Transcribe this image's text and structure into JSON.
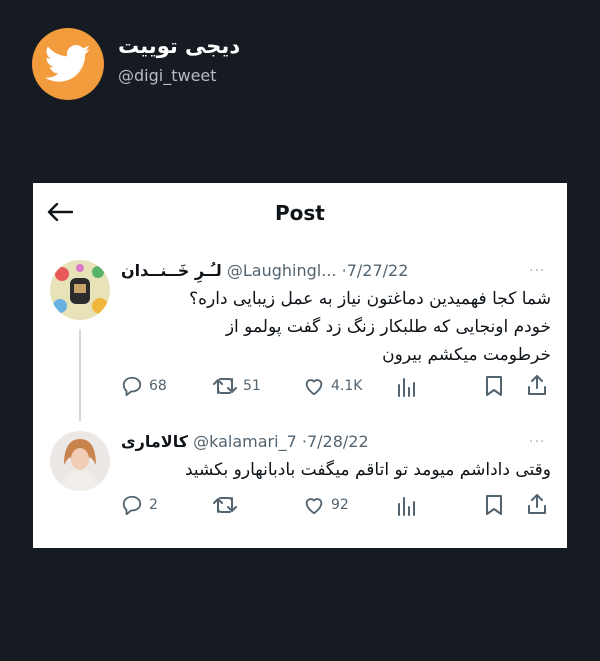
{
  "brand": {
    "name": "دیجی توییت",
    "handle": "@digi_tweet"
  },
  "header": {
    "title": "Post"
  },
  "tweets": [
    {
      "name": "لـُـرِ خَــنــدان",
      "handle": "@Laughingl...",
      "date": "7/27/22",
      "more": "···",
      "lines": [
        "شما کجا فهمیدین دماغتون نیاز به عمل زیبایی داره؟",
        "خودم اونجایی که طلبکار زنگ زد گفت پولمو از",
        "خرطومت میکشم بیرون"
      ],
      "replies": "68",
      "retweets": "51",
      "likes": "4.1K"
    },
    {
      "name": "کالاماری",
      "handle": "@kalamari_7",
      "date": "7/28/22",
      "more": "···",
      "lines": [
        "وقتی داداشم میومد تو اتاقم میگفت بادبانهارو بکشید"
      ],
      "replies": "2",
      "retweets": "",
      "likes": "92"
    }
  ],
  "icons": {
    "brand": "twitter-bird-icon",
    "back": "back-arrow-icon",
    "reply": "reply-icon",
    "retweet": "retweet-icon",
    "like": "heart-icon",
    "views": "analytics-icon",
    "bookmark": "bookmark-icon",
    "share": "share-icon"
  },
  "colors": {
    "background": "#161b22",
    "brand_orange": "#f39c3d",
    "card": "#ffffff",
    "muted": "#536471"
  }
}
